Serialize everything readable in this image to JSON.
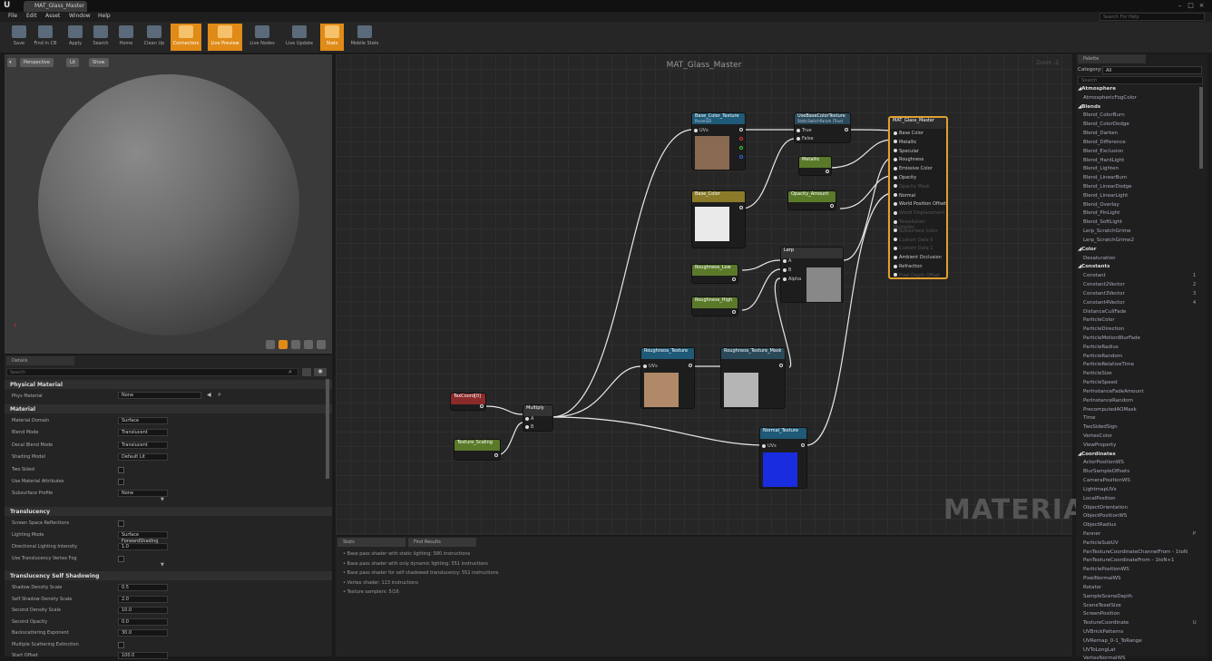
{
  "window": {
    "tab_title": "MAT_Glass_Master"
  },
  "menu": [
    "File",
    "Edit",
    "Asset",
    "Window",
    "Help"
  ],
  "help_search": "Search For Help",
  "toolbar": [
    {
      "label": "Save",
      "active": false
    },
    {
      "label": "Find in CB",
      "active": false
    },
    {
      "label": "Apply",
      "active": false
    },
    {
      "label": "Search",
      "active": false
    },
    {
      "label": "Home",
      "active": false
    },
    {
      "label": "Clean Up",
      "active": false
    },
    {
      "label": "Connectors",
      "active": true
    },
    {
      "label": "Live Preview",
      "active": true
    },
    {
      "label": "Live Nodes",
      "active": false
    },
    {
      "label": "Live Update",
      "active": false
    },
    {
      "label": "Stats",
      "active": true
    },
    {
      "label": "Mobile Stats",
      "active": false
    }
  ],
  "viewport": {
    "buttons": [
      "Perspective",
      "Lit",
      "Show"
    ]
  },
  "details": {
    "tab": "Details",
    "search": "Search",
    "sections": {
      "physical": "Physical Material",
      "material": "Material",
      "translucency": "Translucency",
      "self_shadow": "Translucency Self Shadowing"
    },
    "phys_material": {
      "label": "Phys Material",
      "value": "None"
    },
    "rows_material": [
      {
        "label": "Material Domain",
        "value": "Surface"
      },
      {
        "label": "Blend Mode",
        "value": "Translucent"
      },
      {
        "label": "Decal Blend Mode",
        "value": "Translucent"
      },
      {
        "label": "Shading Model",
        "value": "Default Lit"
      },
      {
        "label": "Two Sided",
        "value": ""
      },
      {
        "label": "Use Material Attributes",
        "value": ""
      },
      {
        "label": "Subsurface Profile",
        "value": "None"
      }
    ],
    "rows_transl": [
      {
        "label": "Screen Space Reflections",
        "value": ""
      },
      {
        "label": "Lighting Mode",
        "value": "Surface ForwardShading"
      },
      {
        "label": "Directional Lighting Intensity",
        "value": "1.0"
      },
      {
        "label": "Use Translucency Vertex Fog",
        "value": ""
      }
    ],
    "rows_shadow": [
      {
        "label": "Shadow Density Scale",
        "value": "0.5"
      },
      {
        "label": "Self Shadow Density Scale",
        "value": "2.0"
      },
      {
        "label": "Second Density Scale",
        "value": "10.0"
      },
      {
        "label": "Second Opacity",
        "value": "0.0"
      },
      {
        "label": "Backscattering Exponent",
        "value": "30.0"
      },
      {
        "label": "Multiple Scattering Extinction",
        "value": ""
      },
      {
        "label": "Start Offset",
        "value": "100.0"
      }
    ]
  },
  "graph": {
    "title": "MAT_Glass_Master",
    "zoom": "Zoom -2",
    "watermark": "MATERIAL",
    "nodes": {
      "base_color_tex": "Base_Color_Texture",
      "base_color_tex_sub": "Param2D",
      "use_base_color": "UseBaseColorTexture",
      "use_base_color_sub": "StaticSwitchParam (True)",
      "base_color": "Base_Color",
      "metallic": "Metallic",
      "opacity": "Opacity_Amount",
      "lerp": "Lerp",
      "rough_low": "Roughness_Low",
      "rough_high": "Roughness_High",
      "rough_tex": "Roughness_Texture",
      "rough_mask": "Roughness_Texture_Mask",
      "texcoord": "TexCoord[0]",
      "multiply": "Multiply",
      "tex_scaling": "Texture_Scaling",
      "normal_tex": "Normal_Texture",
      "result": "MAT_Glass_Master",
      "pin_uvs": "UVs",
      "pin_true": "True",
      "pin_false": "False",
      "pin_a": "A",
      "pin_b": "B",
      "pin_alpha": "Alpha"
    },
    "result_pins": [
      "Base Color",
      "Metallic",
      "Specular",
      "Roughness",
      "Emissive Color",
      "Opacity",
      "Opacity Mask",
      "Normal",
      "World Position Offset",
      "World Displacement",
      "Tessellation Multiplier",
      "Subsurface Color",
      "Custom Data 0",
      "Custom Data 1",
      "Ambient Occlusion",
      "Refraction",
      "Pixel Depth Offset"
    ]
  },
  "stats": {
    "tabs": [
      "Stats",
      "Find Results"
    ],
    "lines": [
      "Base pass shader with static lighting: 580 instructions",
      "Base pass shader with only dynamic lighting: 551 instructions",
      "Base pass shader for self shadowed translucency: 551 instructions",
      "Vertex shader: 113 instructions",
      "Texture samplers: 5/16"
    ]
  },
  "palette": {
    "tab": "Palette",
    "category_label": "Category:",
    "category_value": "All",
    "search": "Search",
    "items": [
      {
        "t": "c",
        "n": "Atmosphere"
      },
      {
        "t": "i",
        "n": "AtmosphericFogColor"
      },
      {
        "t": "c",
        "n": "Blends"
      },
      {
        "t": "i",
        "n": "Blend_ColorBurn"
      },
      {
        "t": "i",
        "n": "Blend_ColorDodge"
      },
      {
        "t": "i",
        "n": "Blend_Darken"
      },
      {
        "t": "i",
        "n": "Blend_Difference"
      },
      {
        "t": "i",
        "n": "Blend_Exclusion"
      },
      {
        "t": "i",
        "n": "Blend_HardLight"
      },
      {
        "t": "i",
        "n": "Blend_Lighten"
      },
      {
        "t": "i",
        "n": "Blend_LinearBurn"
      },
      {
        "t": "i",
        "n": "Blend_LinearDodge"
      },
      {
        "t": "i",
        "n": "Blend_LinearLight"
      },
      {
        "t": "i",
        "n": "Blend_Overlay"
      },
      {
        "t": "i",
        "n": "Blend_PinLight"
      },
      {
        "t": "i",
        "n": "Blend_SoftLight"
      },
      {
        "t": "i",
        "n": "Lerp_ScratchGrime"
      },
      {
        "t": "i",
        "n": "Lerp_ScratchGrime2"
      },
      {
        "t": "c",
        "n": "Color"
      },
      {
        "t": "i",
        "n": "Desaturation"
      },
      {
        "t": "c",
        "n": "Constants"
      },
      {
        "t": "i",
        "n": "Constant",
        "k": "1"
      },
      {
        "t": "i",
        "n": "Constant2Vector",
        "k": "2"
      },
      {
        "t": "i",
        "n": "Constant3Vector",
        "k": "3"
      },
      {
        "t": "i",
        "n": "Constant4Vector",
        "k": "4"
      },
      {
        "t": "i",
        "n": "DistanceCullFade"
      },
      {
        "t": "i",
        "n": "ParticleColor"
      },
      {
        "t": "i",
        "n": "ParticleDirection"
      },
      {
        "t": "i",
        "n": "ParticleMotionBlurFade"
      },
      {
        "t": "i",
        "n": "ParticleRadius"
      },
      {
        "t": "i",
        "n": "ParticleRandom"
      },
      {
        "t": "i",
        "n": "ParticleRelativeTime"
      },
      {
        "t": "i",
        "n": "ParticleSize"
      },
      {
        "t": "i",
        "n": "ParticleSpeed"
      },
      {
        "t": "i",
        "n": "PerInstanceFadeAmount"
      },
      {
        "t": "i",
        "n": "PerInstanceRandom"
      },
      {
        "t": "i",
        "n": "PrecomputedAOMask"
      },
      {
        "t": "i",
        "n": "Time"
      },
      {
        "t": "i",
        "n": "TwoSidedSign"
      },
      {
        "t": "i",
        "n": "VertexColor"
      },
      {
        "t": "i",
        "n": "ViewProperty"
      },
      {
        "t": "c",
        "n": "Coordinates"
      },
      {
        "t": "i",
        "n": "ActorPositionWS"
      },
      {
        "t": "i",
        "n": "BlurSampleOffsets"
      },
      {
        "t": "i",
        "n": "CameraPositionWS"
      },
      {
        "t": "i",
        "n": "LightmapUVs"
      },
      {
        "t": "i",
        "n": "LocalPosition"
      },
      {
        "t": "i",
        "n": "ObjectOrientation"
      },
      {
        "t": "i",
        "n": "ObjectPositionWS"
      },
      {
        "t": "i",
        "n": "ObjectRadius"
      },
      {
        "t": "i",
        "n": "Panner",
        "k": "P"
      },
      {
        "t": "i",
        "n": "ParticleSubUV"
      },
      {
        "t": "i",
        "n": "PanTextureCoordinateChannelFrom - 1toN"
      },
      {
        "t": "i",
        "n": "PanTextureCoordinateFrom - 1toN+1"
      },
      {
        "t": "i",
        "n": "ParticlePositionWS"
      },
      {
        "t": "i",
        "n": "PixelNormalWS"
      },
      {
        "t": "i",
        "n": "Rotator"
      },
      {
        "t": "i",
        "n": "SampleSceneDepth"
      },
      {
        "t": "i",
        "n": "SceneTexelSize"
      },
      {
        "t": "i",
        "n": "ScreenPosition"
      },
      {
        "t": "i",
        "n": "TextureCoordinate",
        "k": "U"
      },
      {
        "t": "i",
        "n": "UVBrickPatterns"
      },
      {
        "t": "i",
        "n": "UVRemap_0-1_ToRange"
      },
      {
        "t": "i",
        "n": "UVToLongLat"
      },
      {
        "t": "i",
        "n": "VertexNormalWS"
      }
    ]
  },
  "colors": {
    "accent": "#e08b18",
    "texture_node": "#1f5a78",
    "param_node": "#5a7a2a",
    "result_border": "#e0a030",
    "switch_node": "#2a4a5a"
  }
}
